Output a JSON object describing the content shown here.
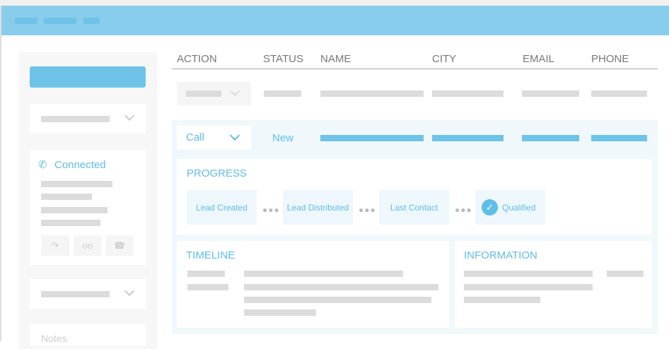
{
  "table": {
    "headers": [
      "ACTION",
      "STATUS",
      "NAME",
      "CITY",
      "EMAIL",
      "PHONE"
    ]
  },
  "active_row": {
    "action": "Call",
    "status": "New"
  },
  "call": {
    "status": "Connected"
  },
  "progress": {
    "title": "PROGRESS",
    "steps": [
      "Lead Created",
      "Lead Distributed",
      "Last Contact",
      "Qualified"
    ]
  },
  "timeline": {
    "title": "TIMELINE"
  },
  "information": {
    "title": "INFORMATION"
  },
  "notes": {
    "placeholder": "Notes"
  },
  "colors": {
    "header": "#88cdec",
    "accent": "#6ec4e8",
    "panel": "#f0f8fc"
  }
}
